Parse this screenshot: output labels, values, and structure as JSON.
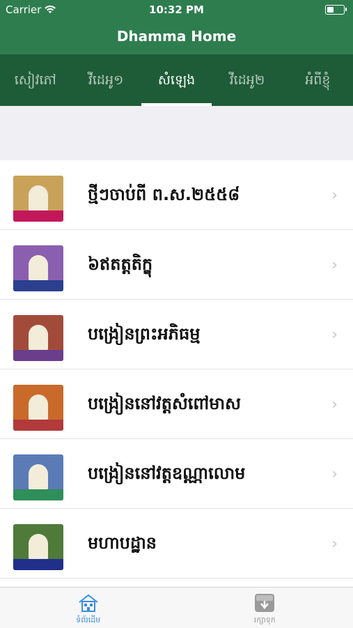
{
  "status": {
    "carrier": "Carrier",
    "time": "10:32 PM"
  },
  "nav": {
    "title": "Dhamma Home"
  },
  "tabs": [
    {
      "label": "សៀវភៅ",
      "active": false
    },
    {
      "label": "វីដេអូ១",
      "active": false
    },
    {
      "label": "សំឡេង",
      "active": true
    },
    {
      "label": "វីដេអូ២",
      "active": false
    },
    {
      "label": "អំពីខ្ញុំ",
      "active": false
    }
  ],
  "list": [
    {
      "title": "ថ្មីៗចាប់ពី ព.ស.២៥៥៨",
      "thumb_bg": "#c9a25a",
      "thumb_band": "#c2185b"
    },
    {
      "title": "៦ឥតត្តតិក្ខុ",
      "thumb_bg": "#8a5fb0",
      "thumb_band": "#2c3f8f"
    },
    {
      "title": "បង្រៀនព្រះអភិធម្ម",
      "thumb_bg": "#a34b3a",
      "thumb_band": "#6a3e8a"
    },
    {
      "title": "បង្រៀននៅវត្តសំពៅមាស",
      "thumb_bg": "#c96a2a",
      "thumb_band": "#b23a3a"
    },
    {
      "title": "បង្រៀននៅវត្តឧណ្ណាលោម",
      "thumb_bg": "#5a7bb5",
      "thumb_band": "#2f8f5a"
    },
    {
      "title": "មហាបដ្ឋាន",
      "thumb_bg": "#4f7a3a",
      "thumb_band": "#1f2f8a"
    }
  ],
  "tabbar": [
    {
      "label": "ទំព័រដើម",
      "icon": "home-icon",
      "active": true
    },
    {
      "label": "រក្សាទុក",
      "icon": "download-box-icon",
      "active": false
    }
  ],
  "colors": {
    "primary": "#2e7d4f",
    "tabs_bg": "#1d5c37",
    "active_tab": "#3b8de0"
  }
}
